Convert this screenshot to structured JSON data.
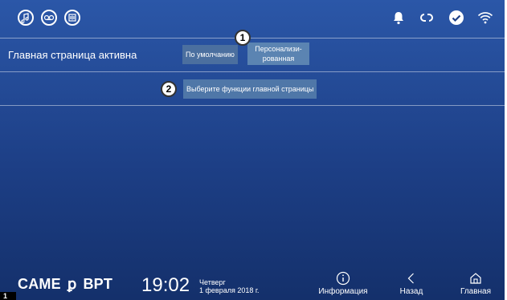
{
  "topbar": {
    "left_icons": [
      "music-note-icon",
      "voicemail-icon",
      "speaker-icon"
    ],
    "right_icons": [
      "bell-icon",
      "link-icon",
      "check-icon",
      "wifi-icon"
    ]
  },
  "row1": {
    "title": "Главная страница активна",
    "option_default": "По умолчанию",
    "option_custom_line1": "Персонализи-",
    "option_custom_line2": "рованная"
  },
  "row2": {
    "select_label": "Выберите функции главной страницы"
  },
  "callouts": {
    "one": "1",
    "two": "2"
  },
  "bottombar": {
    "brand_left": "CAME",
    "brand_right": "BPT",
    "time": "19:02",
    "day": "Четверг",
    "date": "1 февраля 2018 г.",
    "nav_info": "Информация",
    "nav_back": "Назад",
    "nav_home": "Главная",
    "figure_badge": "1"
  },
  "colors": {
    "screen_top": "#2b57a8",
    "screen_bottom": "#14306b",
    "button_default": "#4b6f9f",
    "button_custom": "#5b84b2"
  }
}
